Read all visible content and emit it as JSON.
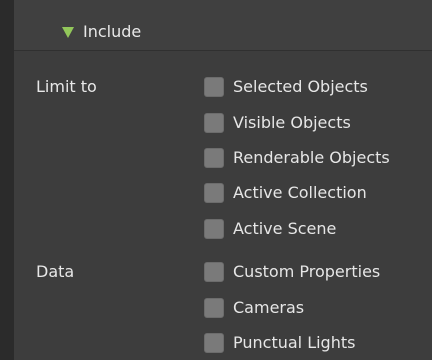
{
  "panel": {
    "header": {
      "label": "Include",
      "icon": "disclosure-triangle-down-icon",
      "icon_color": "#92c75a"
    },
    "sections": [
      {
        "label": "Limit to",
        "options": [
          {
            "label": "Selected Objects",
            "checked": false
          },
          {
            "label": "Visible Objects",
            "checked": false
          },
          {
            "label": "Renderable Objects",
            "checked": false
          },
          {
            "label": "Active Collection",
            "checked": false
          },
          {
            "label": "Active Scene",
            "checked": false
          }
        ]
      },
      {
        "label": "Data",
        "options": [
          {
            "label": "Custom Properties",
            "checked": false
          },
          {
            "label": "Cameras",
            "checked": false
          },
          {
            "label": "Punctual Lights",
            "checked": false
          }
        ]
      }
    ]
  }
}
